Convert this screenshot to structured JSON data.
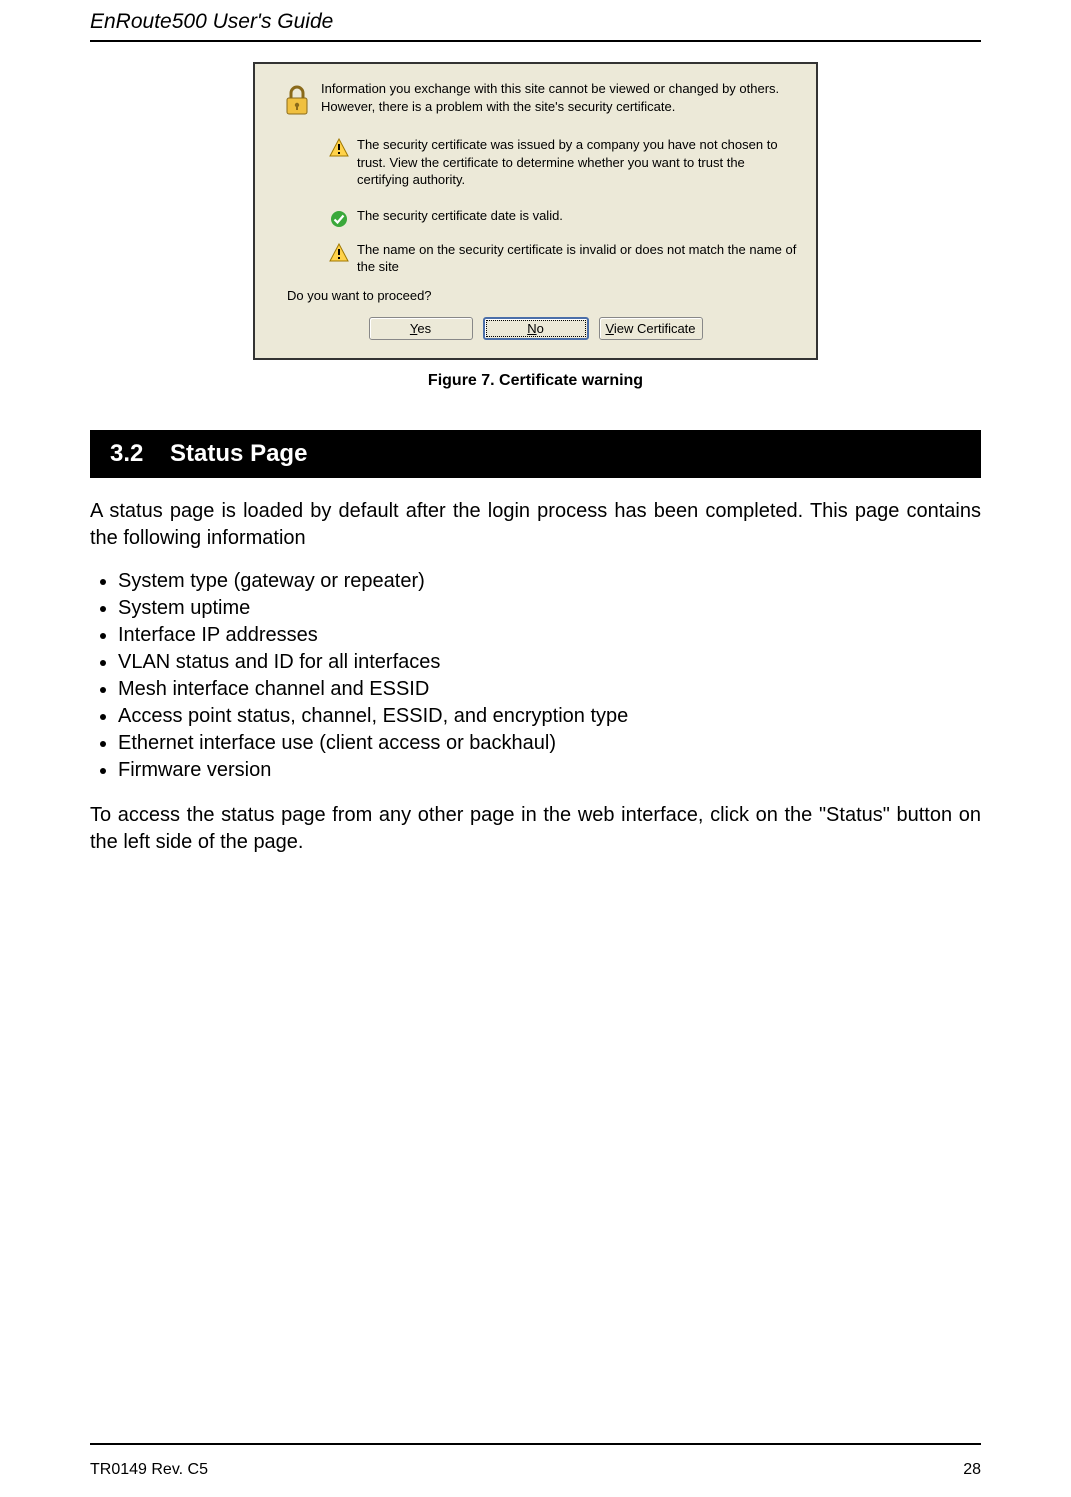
{
  "header": {
    "title": "EnRoute500 User's Guide"
  },
  "dialog": {
    "line1": "Information you exchange with this site cannot be viewed or changed by others. However, there is a problem with the site's security certificate.",
    "line2": "The security certificate was issued by a company you have not chosen to trust. View the certificate to determine whether you want to trust the certifying authority.",
    "line3": "The security certificate date is valid.",
    "line4": "The name on the security certificate is invalid or does not match the name of the site",
    "proceed": "Do you want to proceed?",
    "yes_pre": "",
    "yes_u": "Y",
    "yes_post": "es",
    "no_pre": "",
    "no_u": "N",
    "no_post": "o",
    "view_pre": "",
    "view_u": "V",
    "view_post": "iew Certificate"
  },
  "figure_caption": "Figure 7. Certificate warning",
  "section": {
    "number": "3.2",
    "title": "Status Page"
  },
  "para1": "A status page is loaded by default after the login process has been completed. This page contains the following information",
  "bullets": [
    "System type (gateway or repeater)",
    "System uptime",
    "Interface IP addresses",
    "VLAN status and ID for all interfaces",
    "Mesh interface channel and ESSID",
    "Access point status, channel, ESSID, and encryption type",
    "Ethernet interface use (client access or backhaul)",
    "Firmware version"
  ],
  "para2": "To access the status page from any other page in the web interface, click on the \"Status\" button on the left side of the page.",
  "footer": {
    "left": "TR0149 Rev. C5",
    "right": "28"
  }
}
